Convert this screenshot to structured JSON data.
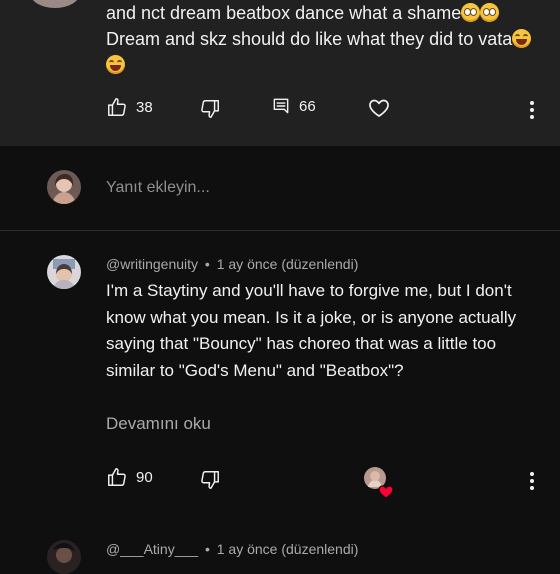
{
  "parent_comment": {
    "text_line1": "and nct dream beatbox dance what a shame",
    "text_line2": "Dream and skz should do like what they did to vata",
    "likes": "38",
    "replies": "66",
    "icons": [
      "thumb-up-icon",
      "thumb-down-icon",
      "comment-icon",
      "heart-icon",
      "more-vert-icon"
    ]
  },
  "reply_bar": {
    "placeholder": "Yanıt ekleyin..."
  },
  "comment": {
    "author": "@writingenuity",
    "separator": "•",
    "time": "1 ay önce (düzenlendi)",
    "body": "I'm a Staytiny and you'll have to forgive me, but I don't know what you mean.  Is it a joke, or is anyone actually saying that \"Bouncy\" has choreo that was a little too similar to \"God's Menu\" and \"Beatbox\"?",
    "read_more": "Devamını oku",
    "likes": "90"
  },
  "next_comment": {
    "author": "@___Atiny___",
    "separator": "•",
    "time": "1 ay önce (düzenlendi)"
  },
  "colors": {
    "background": "#0f0f0f",
    "parent_background": "#212121",
    "text": "#f1f1f1",
    "secondary_text": "#aaaaaa",
    "heart_red": "#ff0033"
  }
}
